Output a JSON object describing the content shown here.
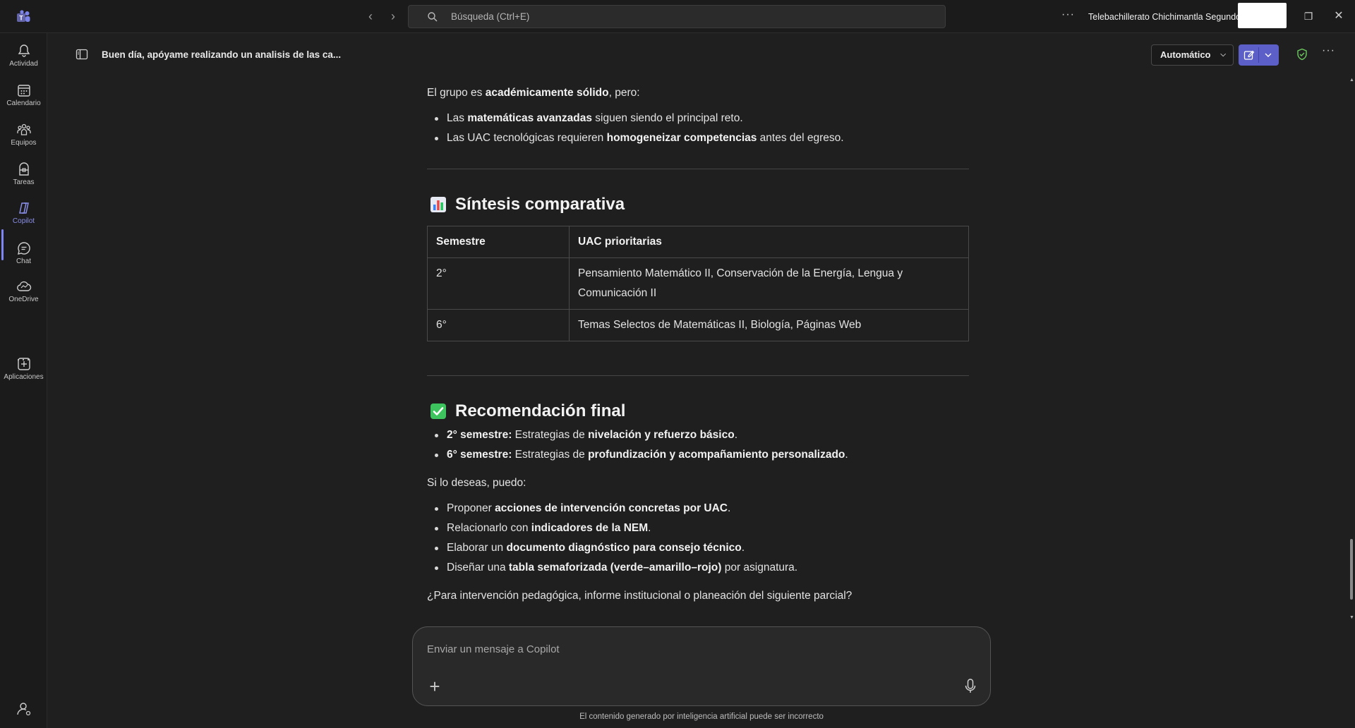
{
  "titlebar": {
    "search_placeholder": "Búsqueda (Ctrl+E)",
    "org_name": "Telebachillerato Chichimantla Segundo",
    "more": "···"
  },
  "rail": {
    "items": [
      {
        "label": "Actividad",
        "icon": "bell-icon"
      },
      {
        "label": "Calendario",
        "icon": "calendar-icon"
      },
      {
        "label": "Equipos",
        "icon": "teams-icon"
      },
      {
        "label": "Tareas",
        "icon": "assignments-icon"
      },
      {
        "label": "Copilot",
        "icon": "copilot-icon",
        "active": true
      },
      {
        "label": "Chat",
        "icon": "chat-icon"
      },
      {
        "label": "OneDrive",
        "icon": "onedrive-icon"
      },
      {
        "label": "Aplicaciones",
        "icon": "apps-icon"
      }
    ],
    "more": "···",
    "accent": "#7f85f5"
  },
  "header": {
    "title": "Buen día, apóyame realizando un analisis de las ca...",
    "mode_label": "Automático",
    "more": "···",
    "brand_color": "#5b5fc7"
  },
  "content": {
    "intro": {
      "pre": "El grupo es ",
      "bold": "académicamente sólido",
      "post": ", pero:"
    },
    "intro_bullets": [
      {
        "pre": "Las ",
        "bold": "matemáticas avanzadas",
        "post": " siguen siendo el principal reto."
      },
      {
        "pre": "Las UAC tecnológicas requieren ",
        "bold": "homogeneizar competencias",
        "post": " antes del egreso."
      }
    ],
    "section1_title": "Síntesis comparativa",
    "table": {
      "headers": [
        "Semestre",
        "UAC prioritarias"
      ],
      "rows": [
        [
          "2°",
          "Pensamiento Matemático II, Conservación de la Energía, Lengua y Comunicación II"
        ],
        [
          "6°",
          "Temas Selectos de Matemáticas II, Biología, Páginas Web"
        ]
      ]
    },
    "section2_title": "Recomendación final",
    "rec_bullets": [
      {
        "lead": "2° semestre:",
        "pre": " Estrategias de ",
        "bold": "nivelación y refuerzo básico",
        "post": "."
      },
      {
        "lead": "6° semestre:",
        "pre": " Estrategias de ",
        "bold": "profundización y acompañamiento personalizado",
        "post": "."
      }
    ],
    "offer_intro": "Si lo deseas, puedo:",
    "offer_bullets": [
      {
        "pre": "Proponer ",
        "bold": "acciones de intervención concretas por UAC",
        "post": "."
      },
      {
        "pre": "Relacionarlo con ",
        "bold": "indicadores de la NEM",
        "post": "."
      },
      {
        "pre": "Elaborar un ",
        "bold": "documento diagnóstico para consejo técnico",
        "post": "."
      },
      {
        "pre": "Diseñar una ",
        "bold": "tabla semaforizada (verde–amarillo–rojo)",
        "post": " por asignatura."
      }
    ],
    "closing_question": "¿Para intervención pedagógica, informe institucional o planeación del siguiente parcial?"
  },
  "composer": {
    "placeholder": "Enviar un mensaje a Copilot",
    "disclaimer": "El contenido generado por inteligencia artificial puede ser incorrecto"
  }
}
